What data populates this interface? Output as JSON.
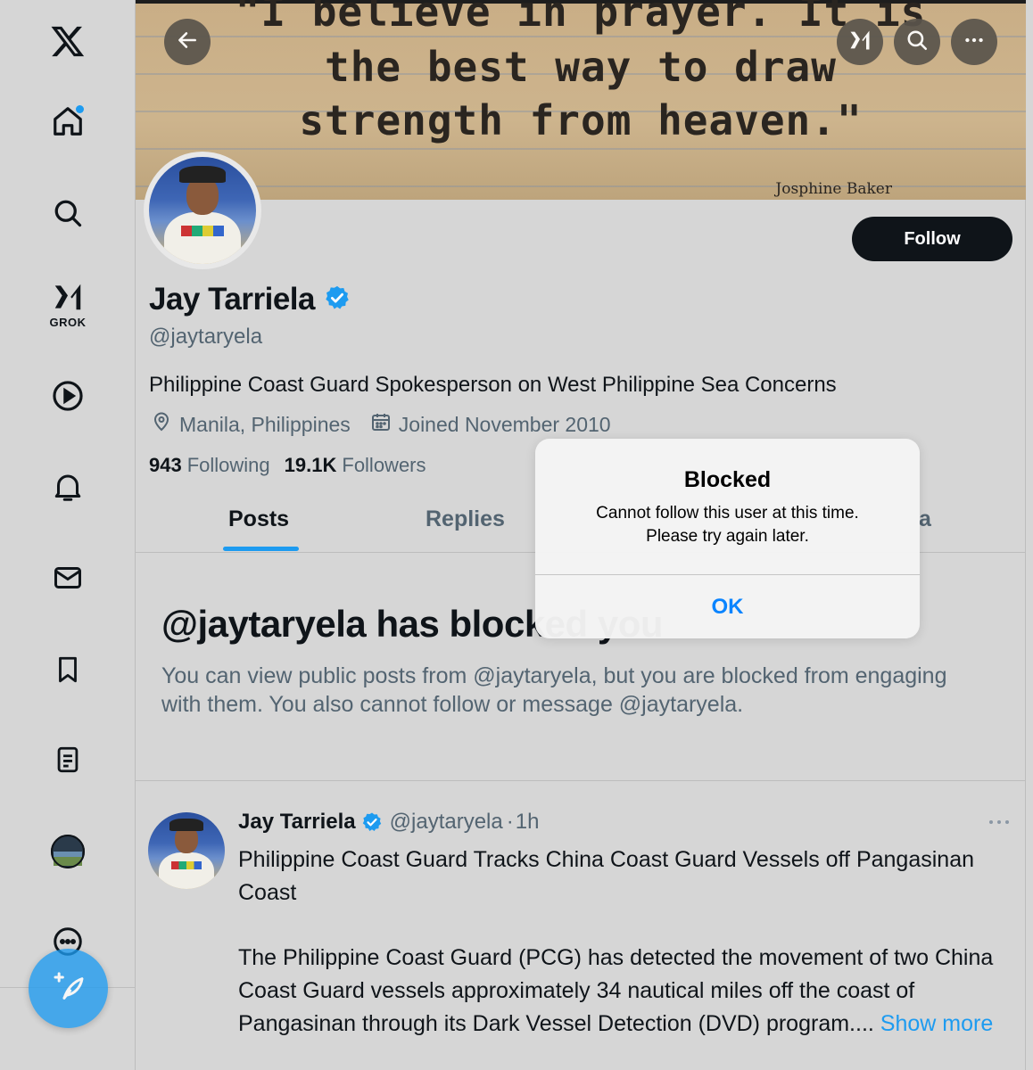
{
  "banner": {
    "quote_line1": "\"I believe in prayer. It is",
    "quote_line2": "the best way to draw",
    "quote_line3": "strength from heaven.\"",
    "author": "Josphine Baker"
  },
  "sidebar": {
    "grok_label": "GROK"
  },
  "profile": {
    "name": "Jay Tarriela",
    "handle": "@jaytaryela",
    "bio": "Philippine Coast Guard Spokesperson on West Philippine Sea Concerns",
    "location": "Manila, Philippines",
    "joined": "Joined November 2010",
    "following_count": "943",
    "following_label": "Following",
    "followers_count": "19.1K",
    "followers_label": "Followers",
    "follow_label": "Follow"
  },
  "tabs": [
    {
      "label": "Posts"
    },
    {
      "label": "Replies"
    },
    {
      "label": "a"
    }
  ],
  "blocked": {
    "title": "@jaytaryela has blocked you",
    "text": "You can view public posts from @jaytaryela, but you are blocked from engaging with them. You also cannot follow or message @jaytaryela."
  },
  "tweet": {
    "name": "Jay Tarriela",
    "handle": "@jaytaryela",
    "separator": "·",
    "time": "1h",
    "headline": "Philippine Coast Guard Tracks China Coast Guard Vessels off Pangasinan Coast",
    "body": "The Philippine Coast Guard (PCG) has detected the movement of two China Coast Guard vessels approximately 34 nautical miles off the coast of Pangasinan through its Dark Vessel Detection (DVD) program....",
    "show_more": "Show more"
  },
  "alert": {
    "title": "Blocked",
    "message_line1": "Cannot follow this user at this time.",
    "message_line2": "Please try again later.",
    "ok_label": "OK"
  },
  "colors": {
    "accent": "#1d9bf0",
    "ios_blue": "#0a84ff",
    "background": "#d6d6d6",
    "text_primary": "#0f1419",
    "text_secondary": "#536471"
  }
}
